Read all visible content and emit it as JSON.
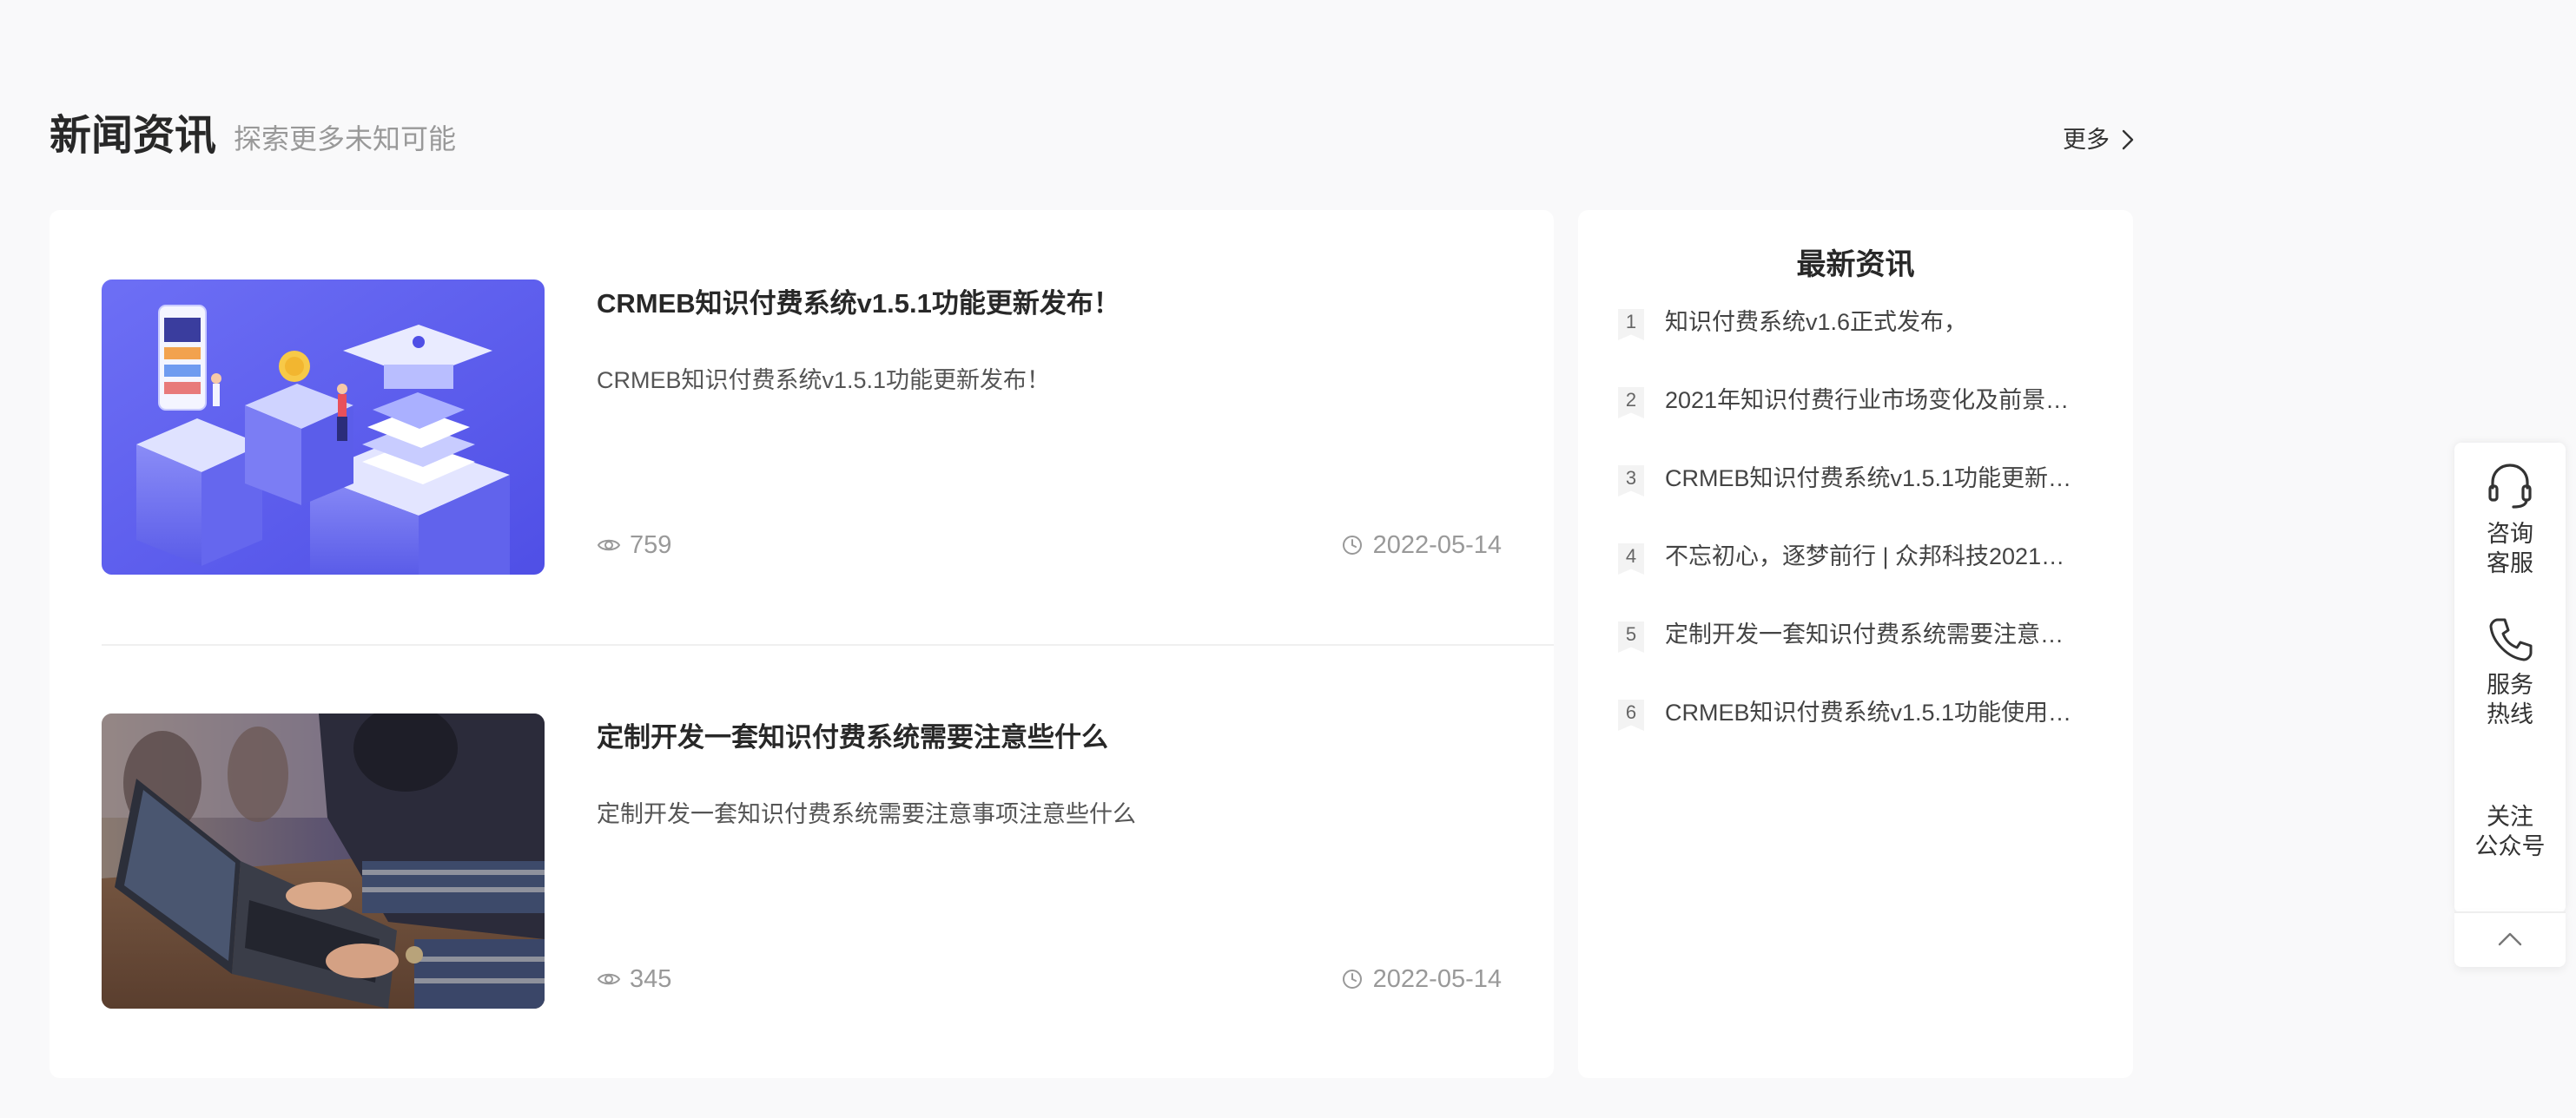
{
  "section": {
    "title": "新闻资讯",
    "subtitle": "探索更多未知可能",
    "more_label": "更多"
  },
  "articles": [
    {
      "title": "CRMEB知识付费系统v1.5.1功能更新发布！",
      "summary": "CRMEB知识付费系统v1.5.1功能更新发布！",
      "views": "759",
      "date": "2022-05-14"
    },
    {
      "title": "定制开发一套知识付费系统需要注意些什么",
      "summary": "定制开发一套知识付费系统需要注意事项注意些什么",
      "views": "345",
      "date": "2022-05-14"
    }
  ],
  "latest": {
    "title": "最新资讯",
    "items": [
      {
        "rank": "1",
        "text": "知识付费系统v1.6正式发布，"
      },
      {
        "rank": "2",
        "text": "2021年知识付费行业市场变化及前景…"
      },
      {
        "rank": "3",
        "text": "CRMEB知识付费系统v1.5.1功能更新…"
      },
      {
        "rank": "4",
        "text": "不忘初心，逐梦前行 | 众邦科技2021…"
      },
      {
        "rank": "5",
        "text": "定制开发一套知识付费系统需要注意…"
      },
      {
        "rank": "6",
        "text": "CRMEB知识付费系统v1.5.1功能使用…"
      }
    ]
  },
  "toolbar": {
    "consult_line1": "咨询",
    "consult_line2": "客服",
    "hotline_line1": "服务",
    "hotline_line2": "热线",
    "follow_line1": "关注",
    "follow_line2": "公众号"
  },
  "colors": {
    "page_bg": "#f9f9fa",
    "panel_bg": "#ffffff",
    "title_text": "#282828",
    "muted_text": "#999999",
    "thumb_1_primary": "#5b5ef0",
    "thumb_2_primary": "#6b5f5a"
  },
  "icons": {
    "more": "chevron-right-icon",
    "views": "eye-icon",
    "date": "clock-icon",
    "consult": "headset-icon",
    "hotline": "phone-icon",
    "back_to_top": "chevron-up-icon"
  }
}
